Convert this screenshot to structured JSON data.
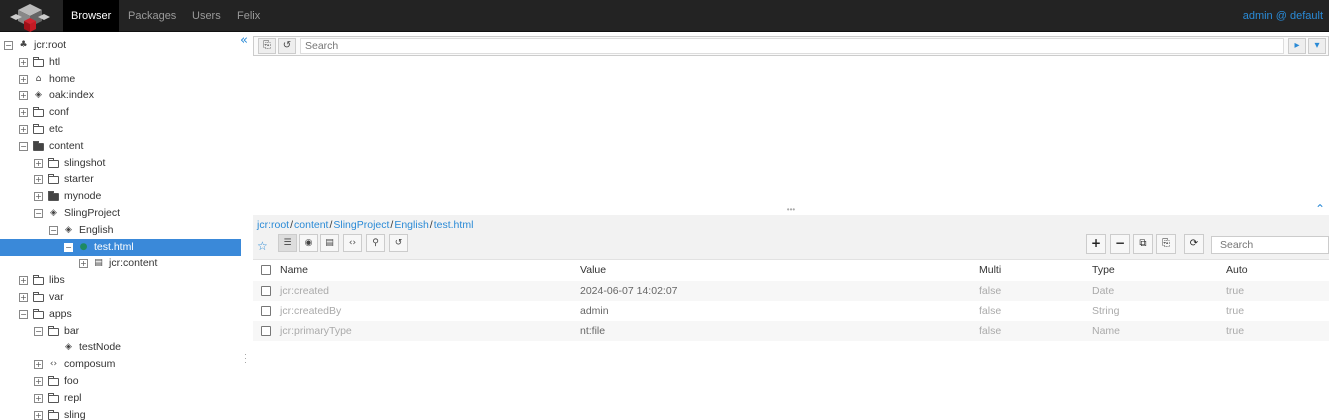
{
  "nav": {
    "tabs": [
      "Browser",
      "Packages",
      "Users",
      "Felix"
    ],
    "user": "admin",
    "at": "@",
    "workspace": "default"
  },
  "tree": [
    {
      "label": "jcr:root",
      "icon": "root-icon",
      "level": 0,
      "toggle": "minus"
    },
    {
      "label": "htl",
      "icon": "folder-icon",
      "level": 1,
      "toggle": "plus"
    },
    {
      "label": "home",
      "icon": "home-icon",
      "level": 1,
      "toggle": "plus"
    },
    {
      "label": "oak:index",
      "icon": "node-icon",
      "level": 1,
      "toggle": "plus"
    },
    {
      "label": "conf",
      "icon": "folder-icon",
      "level": 1,
      "toggle": "plus"
    },
    {
      "label": "etc",
      "icon": "folder-icon",
      "level": 1,
      "toggle": "plus"
    },
    {
      "label": "content",
      "icon": "folder-filled-icon",
      "level": 1,
      "toggle": "minus"
    },
    {
      "label": "slingshot",
      "icon": "folder-icon",
      "level": 2,
      "toggle": "plus"
    },
    {
      "label": "starter",
      "icon": "folder-icon",
      "level": 2,
      "toggle": "plus"
    },
    {
      "label": "mynode",
      "icon": "folder-filled-icon",
      "level": 2,
      "toggle": "plus"
    },
    {
      "label": "SlingProject",
      "icon": "node-icon",
      "level": 2,
      "toggle": "minus"
    },
    {
      "label": "English",
      "icon": "node-icon",
      "level": 3,
      "toggle": "minus"
    },
    {
      "label": "test.html",
      "icon": "file-icon",
      "level": 4,
      "toggle": "minus",
      "selected": true
    },
    {
      "label": "jcr:content",
      "icon": "page-icon",
      "level": 5,
      "toggle": "plus"
    },
    {
      "label": "libs",
      "icon": "folder-icon",
      "level": 1,
      "toggle": "plus"
    },
    {
      "label": "var",
      "icon": "folder-icon",
      "level": 1,
      "toggle": "plus"
    },
    {
      "label": "apps",
      "icon": "folder-icon",
      "level": 1,
      "toggle": "minus"
    },
    {
      "label": "bar",
      "icon": "folder-icon",
      "level": 2,
      "toggle": "minus"
    },
    {
      "label": "testNode",
      "icon": "node-icon",
      "level": 3,
      "toggle": "none"
    },
    {
      "label": "composum",
      "icon": "code-icon",
      "level": 2,
      "toggle": "plus"
    },
    {
      "label": "foo",
      "icon": "folder-icon",
      "level": 2,
      "toggle": "plus"
    },
    {
      "label": "repl",
      "icon": "folder-icon",
      "level": 2,
      "toggle": "plus"
    },
    {
      "label": "sling",
      "icon": "folder-icon",
      "level": 2,
      "toggle": "plus"
    }
  ],
  "search": {
    "placeholder": "Search"
  },
  "breadcrumb": [
    "jcr:root",
    "content",
    "SlingProject",
    "English",
    "test.html"
  ],
  "breadcrumb_sep": "/",
  "props": {
    "search_placeholder": "Search",
    "columns": [
      "Name",
      "Value",
      "Multi",
      "Type",
      "Auto"
    ],
    "rows": [
      {
        "name": "jcr:created",
        "value": "2024-06-07 14:02:07",
        "multi": "false",
        "type": "Date",
        "auto": "true"
      },
      {
        "name": "jcr:createdBy",
        "value": "admin",
        "multi": "false",
        "type": "String",
        "auto": "true"
      },
      {
        "name": "jcr:primaryType",
        "value": "nt:file",
        "multi": "false",
        "type": "Name",
        "auto": "true"
      }
    ]
  },
  "colors": {
    "accent": "#2a8ad6",
    "topbar": "#232323",
    "selected_row": "#3a89d9"
  }
}
